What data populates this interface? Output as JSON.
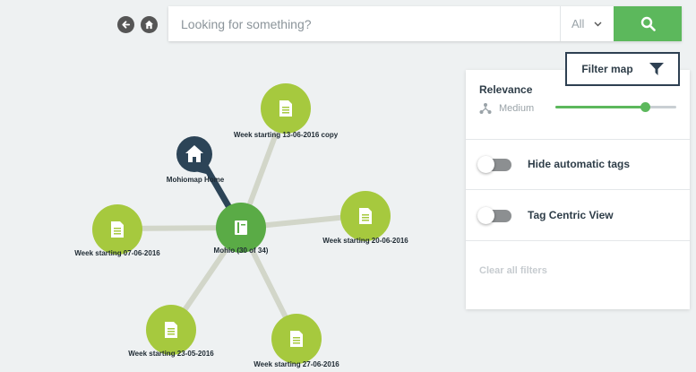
{
  "nav": {
    "back_icon": "arrow-left-icon",
    "home_icon": "home-icon"
  },
  "search": {
    "placeholder": "Looking for something?",
    "value": "",
    "scope": "All",
    "scope_icon": "chevron-down-icon",
    "button_icon": "search-icon"
  },
  "map": {
    "center": {
      "label": "Mohio (30 of 34)",
      "icon": "book-icon"
    },
    "home": {
      "label": "Mohiomap Home",
      "icon": "home-icon"
    },
    "nodes": [
      {
        "label": "Week starting 13-06-2016 copy",
        "icon": "document-icon"
      },
      {
        "label": "Week starting 07-06-2016",
        "icon": "document-icon"
      },
      {
        "label": "Week starting 20-06-2016",
        "icon": "document-icon"
      },
      {
        "label": "Week starting 23-05-2016",
        "icon": "document-icon"
      },
      {
        "label": "Week starting 27-06-2016",
        "icon": "document-icon"
      }
    ]
  },
  "filter": {
    "button_label": "Filter map",
    "button_icon": "funnel-icon",
    "relevance_title": "Relevance",
    "relevance_level": "Medium",
    "relevance_icon": "network-icon",
    "relevance_value_pct": 74,
    "hide_tags_label": "Hide automatic tags",
    "hide_tags_on": false,
    "tag_centric_label": "Tag Centric View",
    "tag_centric_on": false,
    "clear_label": "Clear all filters"
  },
  "colors": {
    "accent_green": "#5cb85c",
    "node_lime": "#a6c93e",
    "node_center": "#5aab46",
    "home_node": "#2c4457",
    "edge": "#d1d5c8"
  }
}
